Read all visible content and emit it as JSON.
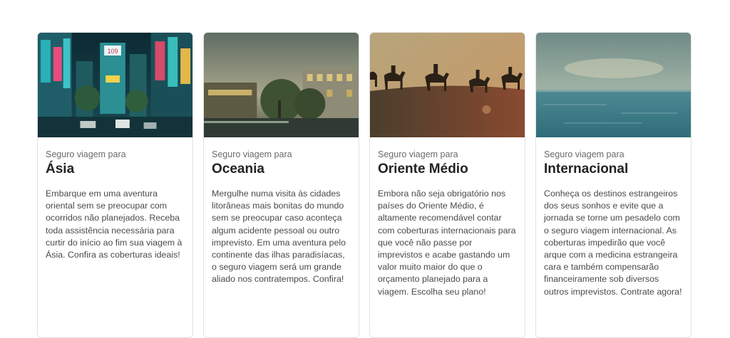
{
  "cards": [
    {
      "eyebrow": "Seguro viagem para",
      "title": "Ásia",
      "description": "Embarque em uma aventura oriental sem se preocupar com ocorridos não planejados. Receba toda assistência necessária para curtir do início ao fim sua viagem à Ásia. Confira as coberturas ideais!",
      "image_alt": "Neon-lit city street at night",
      "sign_text": "109"
    },
    {
      "eyebrow": "Seguro viagem para",
      "title": "Oceania",
      "description": "Mergulhe numa visita às cidades litorâneas mais bonitas do mundo sem se preocupar caso aconteça algum acidente pessoal ou outro imprevisto. Em uma aventura pelo continente das ilhas paradisíacas, o seguro viagem será um grande aliado nos contratempos. Confira!",
      "image_alt": "Riverside city with trees and buildings at dusk"
    },
    {
      "eyebrow": "Seguro viagem para",
      "title": "Oriente Médio",
      "description": "Embora não seja obrigatório nos países do Oriente Médio, é altamente recomendável contar com coberturas internacionais para que você não passe por imprevistos e acabe gastando um valor muito maior do que o orçamento planejado para a viagem. Escolha seu plano!",
      "image_alt": "Camel caravan silhouetted on a desert dune"
    },
    {
      "eyebrow": "Seguro viagem para",
      "title": "Internacional",
      "description": "Conheça os destinos estrangeiros dos seus sonhos e evite que a jornada se torne um pesadelo com o seguro viagem internacional. As coberturas impedirão que você arque com a medicina estrangeira cara e também compensarão financeiramente sob diversos outros imprevistos. Contrate agora!",
      "image_alt": "Calm sea under a hazy sky"
    }
  ]
}
